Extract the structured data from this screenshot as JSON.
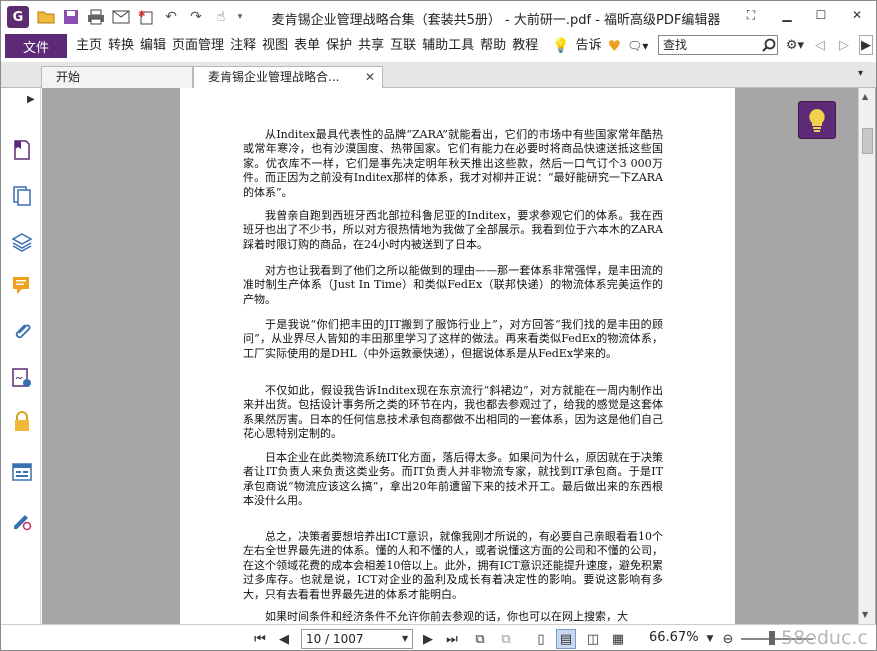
{
  "window": {
    "title": "麦肯锡企业管理战略合集（套装共5册） - 大前研一.pdf - 福昕高级PDF编辑器"
  },
  "menu": {
    "file": "文件",
    "items": [
      "主页",
      "转换",
      "编辑",
      "页面管理",
      "注释",
      "视图",
      "表单",
      "保护",
      "共享",
      "互联",
      "辅助工具",
      "帮助",
      "教程"
    ],
    "tell": "告诉"
  },
  "search": {
    "value": "查找"
  },
  "tabs": [
    {
      "label": "开始"
    },
    {
      "label": "麦肯锡企业管理战略合..."
    }
  ],
  "document": {
    "paragraphs": [
      "从Inditex最具代表性的品牌“ZARA”就能看出，它们的市场中有些国家常年酷热或常年寒冷，也有沙漠国度、热带国家。它们有能力在必要时将商品快速送抵这些国家。优衣库不一样，它们是事先决定明年秋天推出这些款，然后一口气订个3 000万件。而正因为之前没有Inditex那样的体系，我才对柳井正说：“最好能研究一下ZARA的体系”。",
      "我曾亲自跑到西班牙西北部拉科鲁尼亚的Inditex，要求参观它们的体系。我在西班牙也出了不少书，所以对方很热情地为我做了全部展示。我看到位于六本木的ZARA踩着时限订购的商品，在24小时内被送到了日本。",
      "对方也让我看到了他们之所以能做到的理由——那一套体系非常强悍，是丰田流的准时制生产体系（Just In Time）和类似FedEx（联邦快递）的物流体系完美运作的产物。",
      "于是我说“你们把丰田的JIT搬到了服饰行业上”，对方回答“我们找的是丰田的顾问”，从业界尽人皆知的丰田那里学习了这样的做法。再来看类似FedEx的物流体系，工厂实际使用的是DHL（中外运敦豪快递），但据说体系是从FedEx学来的。",
      "不仅如此，假设我告诉Inditex现在东京流行“斜裙边”，对方就能在一周内制作出来并出货。包括设计事务所之类的环节在内，我也都去参观过了，给我的感觉是这套体系果然厉害。日本的任何信息技术承包商都做不出相同的一套体系，因为这是他们自己花心思特别定制的。",
      "日本企业在此类物流系统IT化方面，落后得太多。如果问为什么，原因就在于决策者让IT负责人来负责这类业务。而IT负责人并非物流专家，就找到IT承包商。于是IT承包商说“物流应该这么搞”，拿出20年前遭留下来的技术开工。最后做出来的东西根本没什么用。",
      "总之，决策者要想培养出ICT意识，就像我刚才所说的，有必要自己亲眼看看10个左右全世界最先进的体系。懂的人和不懂的人，或者说懂这方面的公司和不懂的公司，在这个领域花费的成本会相差10倍以上。此外，拥有ICT意识还能提升速度，避免积累过多库存。也就是说，ICT对企业的盈利及成长有着决定性的影响。要说这影响有多大，只有去看看世界最先进的体系才能明白。",
      "如果时间条件和经济条件不允许你前去参观的话，你也可以在网上搜索，大"
    ]
  },
  "status": {
    "page": "10 / 1007",
    "zoom": "66.67%",
    "watermark": "58educ.c"
  },
  "colors": {
    "accent": "#5c2a76",
    "doc_background": "#a6a6a6",
    "tip_bulb": "#f2d04b"
  },
  "icons": {
    "sidebar": [
      "bookmark-icon",
      "pages-icon",
      "layers-icon",
      "comments-icon",
      "attachments-icon",
      "signature-icon",
      "security-icon",
      "form-fields-icon",
      "sign-tool-icon"
    ]
  }
}
